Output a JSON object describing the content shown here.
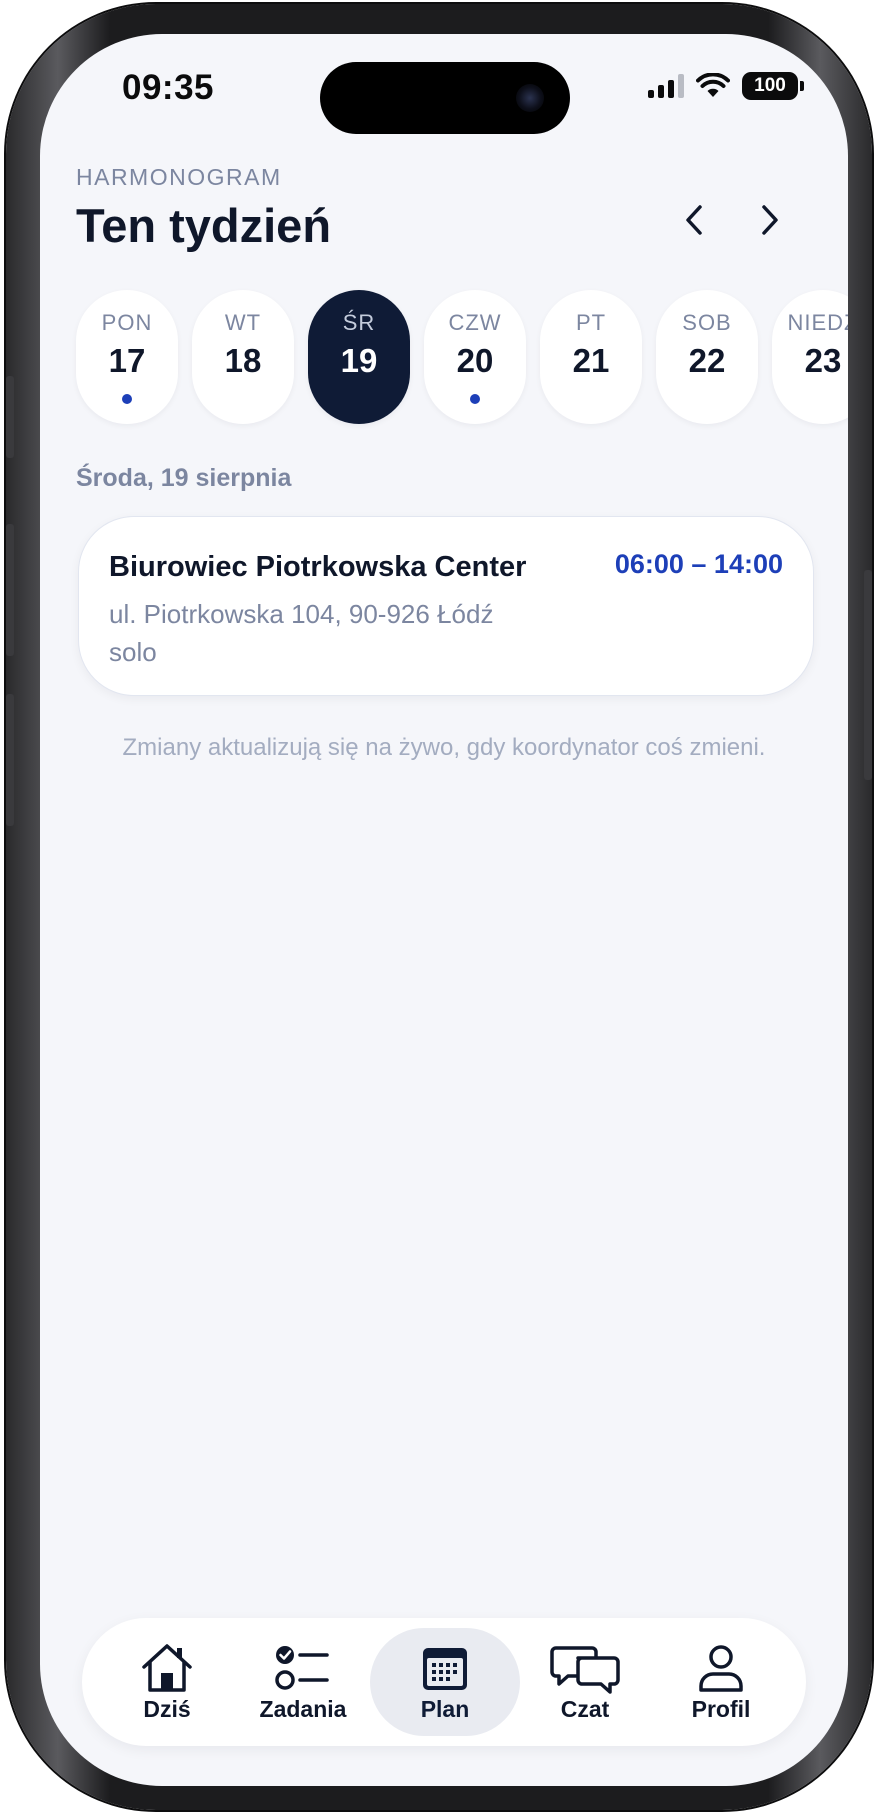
{
  "status_bar": {
    "time": "09:35",
    "battery": "100"
  },
  "header": {
    "eyebrow": "HARMONOGRAM",
    "title": "Ten tydzień"
  },
  "week": {
    "days": [
      {
        "dow": "PON",
        "num": "17",
        "has_event": true,
        "selected": false
      },
      {
        "dow": "WT",
        "num": "18",
        "has_event": false,
        "selected": false
      },
      {
        "dow": "ŚR",
        "num": "19",
        "has_event": false,
        "selected": true
      },
      {
        "dow": "CZW",
        "num": "20",
        "has_event": true,
        "selected": false
      },
      {
        "dow": "PT",
        "num": "21",
        "has_event": false,
        "selected": false
      },
      {
        "dow": "SOB",
        "num": "22",
        "has_event": false,
        "selected": false
      },
      {
        "dow": "NIEDZ",
        "num": "23",
        "has_event": false,
        "selected": false
      }
    ]
  },
  "selected_date": "Środa, 19 sierpnia",
  "shift": {
    "title": "Biurowiec Piotrkowska Center",
    "time": "06:00 – 14:00",
    "address": "ul. Piotrkowska 104, 90-926 Łódź",
    "note": "solo"
  },
  "info": "Zmiany aktualizują się na żywo, gdy koordynator coś zmieni.",
  "tabs": [
    {
      "label": "Dziś",
      "icon": "home-icon",
      "active": false
    },
    {
      "label": "Zadania",
      "icon": "checklist-icon",
      "active": false
    },
    {
      "label": "Plan",
      "icon": "calendar-icon",
      "active": true
    },
    {
      "label": "Czat",
      "icon": "chat-icon",
      "active": false
    },
    {
      "label": "Profil",
      "icon": "user-icon",
      "active": false
    }
  ],
  "colors": {
    "accent": "#1d3fb8",
    "selected_day": "#0f1b36",
    "background": "#f5f6fa",
    "muted_text": "#7c86a0"
  }
}
